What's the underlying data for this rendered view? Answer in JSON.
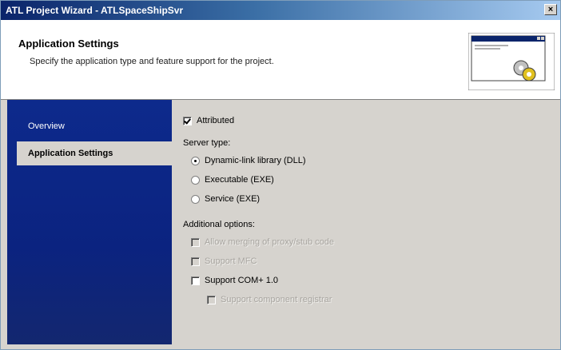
{
  "window": {
    "title": "ATL Project Wizard - ATLSpaceShipSvr",
    "close_glyph": "×"
  },
  "header": {
    "title": "Application Settings",
    "subtitle": "Specify the application type and feature support for the project."
  },
  "sidebar": {
    "items": [
      {
        "label": "Overview",
        "selected": false
      },
      {
        "label": "Application Settings",
        "selected": true
      }
    ]
  },
  "options": {
    "attributed": {
      "label": "Attributed",
      "checked": true
    },
    "server_type_label": "Server type:",
    "server_types": [
      {
        "label": "Dynamic-link library (DLL)",
        "selected": true
      },
      {
        "label": "Executable (EXE)",
        "selected": false
      },
      {
        "label": "Service (EXE)",
        "selected": false
      }
    ],
    "additional_label": "Additional options:",
    "additional": [
      {
        "label": "Allow merging of proxy/stub code",
        "checked": false,
        "enabled": false
      },
      {
        "label": "Support MFC",
        "checked": false,
        "enabled": false
      },
      {
        "label": "Support COM+ 1.0",
        "checked": false,
        "enabled": true
      },
      {
        "label": "Support component registrar",
        "checked": false,
        "enabled": false
      }
    ]
  },
  "colors": {
    "sidebar_bg": "#0d2a8c",
    "dialog_bg": "#d6d3ce",
    "title_gradient_start": "#0a246a"
  }
}
